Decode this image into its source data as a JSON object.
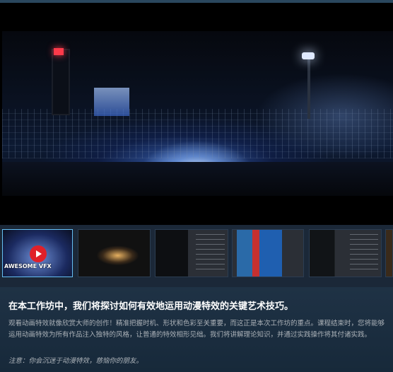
{
  "media": {
    "thumbnails": [
      {
        "kind": "video",
        "caption": "AWESOME VFX",
        "selected": true
      },
      {
        "kind": "screenshot",
        "selected": false
      },
      {
        "kind": "screenshot",
        "selected": false
      },
      {
        "kind": "screenshot",
        "selected": false
      },
      {
        "kind": "screenshot",
        "selected": false
      },
      {
        "kind": "screenshot",
        "selected": false
      }
    ],
    "play_icon": "play-icon"
  },
  "description": {
    "title": "在本工作坊中，我们将探讨如何有效地运用动漫特效的关键艺术技巧。",
    "body": "观看动画特效就像欣赏大师的创作！精准把握时机、形状和色彩至关重要，而这正是本次工作坊的重点。课程结束时，您将能够运用动画特效为所有作品注入独特的风格，让普通的特效相形见绌。我们将讲解理论知识，并通过实践操作将其付诸实践。",
    "note": "注意：你会沉迷于动漫特效，慈恼你的朋友。"
  },
  "colors": {
    "background": "#1b2838",
    "accent": "#66c0f4",
    "play_button": "#e0202a"
  }
}
